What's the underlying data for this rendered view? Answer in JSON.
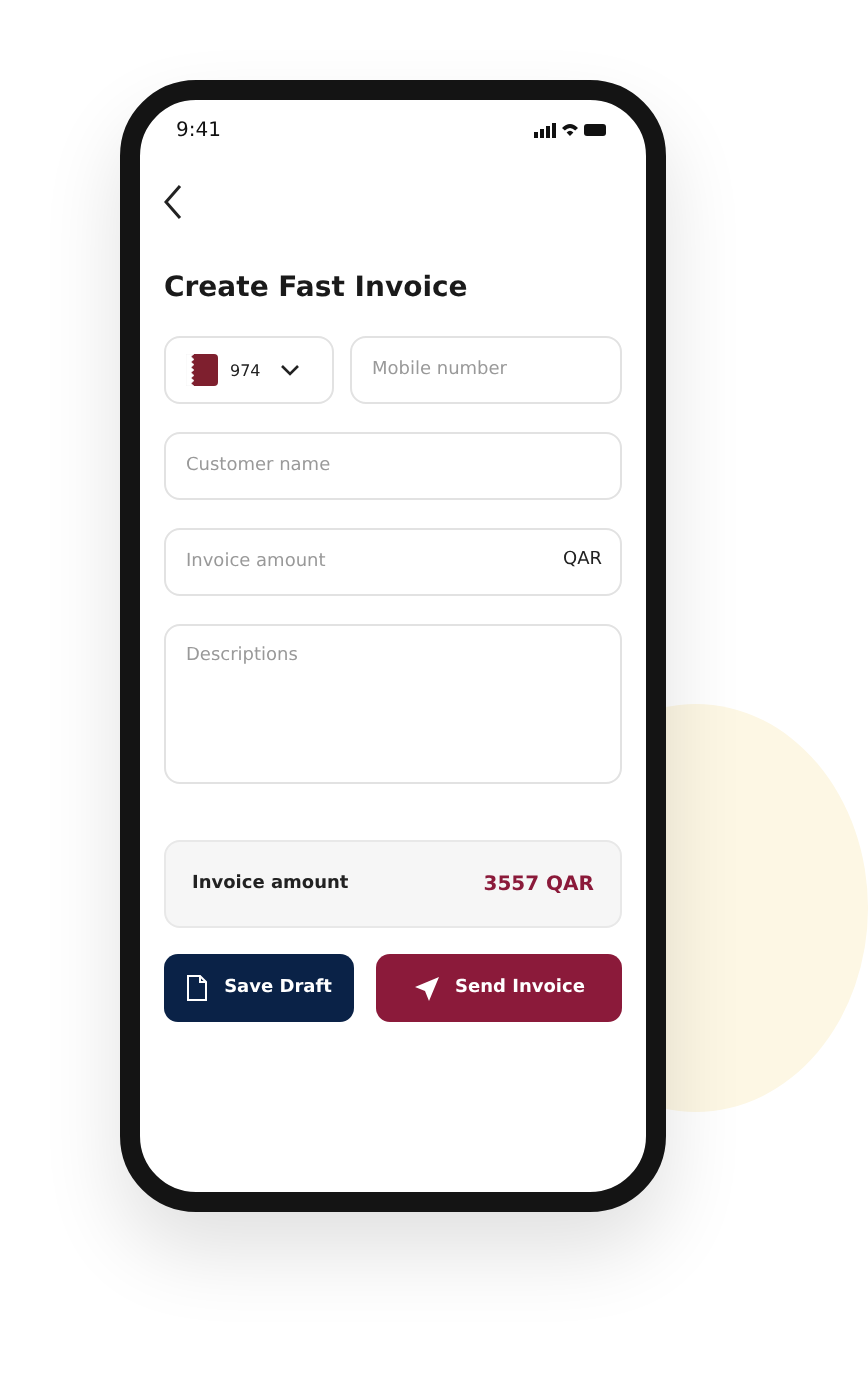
{
  "status_bar": {
    "time": "9:41"
  },
  "title": "Create Fast Invoice",
  "phone": {
    "country_code": "974",
    "placeholder": "Mobile number"
  },
  "customer": {
    "placeholder": "Customer name"
  },
  "amount": {
    "placeholder": "Invoice amount",
    "currency": "QAR"
  },
  "description": {
    "placeholder": "Descriptions"
  },
  "summary": {
    "label": "Invoice amount",
    "value": "3557 QAR"
  },
  "buttons": [
    {
      "kind": "secondary",
      "label": "Save Draft"
    },
    {
      "kind": "primary",
      "label": "Send Invoice"
    }
  ]
}
